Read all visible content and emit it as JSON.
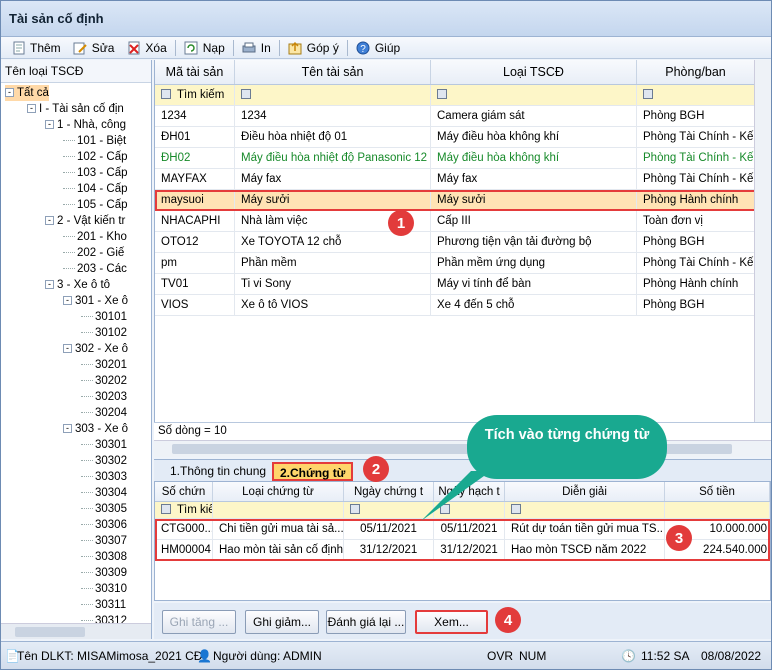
{
  "window": {
    "title": "Tài sản cố định"
  },
  "toolbar": {
    "items": [
      {
        "label": "Thêm",
        "icon": "add-icon"
      },
      {
        "label": "Sửa",
        "icon": "edit-icon"
      },
      {
        "label": "Xóa",
        "icon": "delete-icon"
      },
      {
        "label": "Nạp",
        "icon": "refresh-icon"
      },
      {
        "label": "In",
        "icon": "print-icon"
      },
      {
        "label": "Góp ý",
        "icon": "feedback-icon"
      },
      {
        "label": "Giúp",
        "icon": "help-icon"
      }
    ]
  },
  "tree": {
    "header": "Tên loại TSCĐ",
    "nodes": [
      {
        "label": "Tất cả",
        "box": "-",
        "selected": true
      },
      {
        "label": "I - Tài sản cố địn",
        "box": "-"
      },
      {
        "label": "1 - Nhà, công",
        "box": "-"
      },
      {
        "label": "101 - Biệt",
        "box": ""
      },
      {
        "label": "102 - Cấp",
        "box": ""
      },
      {
        "label": "103 - Cấp",
        "box": ""
      },
      {
        "label": "104 - Cấp",
        "box": ""
      },
      {
        "label": "105 - Cấp",
        "box": ""
      },
      {
        "label": "2 - Vật kiến tr",
        "box": "-"
      },
      {
        "label": "201 - Kho",
        "box": ""
      },
      {
        "label": "202 - Giế",
        "box": ""
      },
      {
        "label": "203 - Các",
        "box": ""
      },
      {
        "label": "3 - Xe ô tô",
        "box": "-"
      },
      {
        "label": "301 - Xe ô",
        "box": "-"
      },
      {
        "label": "30101",
        "box": ""
      },
      {
        "label": "30102",
        "box": ""
      },
      {
        "label": "302 - Xe ô",
        "box": "-"
      },
      {
        "label": "30201",
        "box": ""
      },
      {
        "label": "30202",
        "box": ""
      },
      {
        "label": "30203",
        "box": ""
      },
      {
        "label": "30204",
        "box": ""
      },
      {
        "label": "303 - Xe ô",
        "box": "-"
      },
      {
        "label": "30301",
        "box": ""
      },
      {
        "label": "30302",
        "box": ""
      },
      {
        "label": "30303",
        "box": ""
      },
      {
        "label": "30304",
        "box": ""
      },
      {
        "label": "30305",
        "box": ""
      },
      {
        "label": "30306",
        "box": ""
      },
      {
        "label": "30307",
        "box": ""
      },
      {
        "label": "30308",
        "box": ""
      },
      {
        "label": "30309",
        "box": ""
      },
      {
        "label": "30310",
        "box": ""
      },
      {
        "label": "30311",
        "box": ""
      },
      {
        "label": "30312",
        "box": ""
      }
    ]
  },
  "assets": {
    "columns": [
      "Mã tài sản",
      "Tên tài sản",
      "Loại TSCĐ",
      "Phòng/ban"
    ],
    "filter_label": "Tìm kiếm",
    "rows": [
      {
        "code": "1234",
        "name": "1234",
        "type": "Camera giám sát",
        "dept": "Phòng BGH",
        "style": ""
      },
      {
        "code": "ĐH01",
        "name": "Điều hòa nhiệt độ 01",
        "type": "Máy điều hòa không khí",
        "dept": "Phòng Tài Chính - Kế toán",
        "style": ""
      },
      {
        "code": "ĐH02",
        "name": "Máy điều hòa nhiệt độ Panasonic 12",
        "type": "Máy điều hòa không khí",
        "dept": "Phòng Tài Chính - Kế toán",
        "style": "green"
      },
      {
        "code": "MAYFAX",
        "name": "Máy fax",
        "type": "Máy fax",
        "dept": "Phòng Tài Chính - Kế toán",
        "style": ""
      },
      {
        "code": "maysuoi",
        "name": "Máy sưởi",
        "type": "Máy sưởi",
        "dept": "Phòng Hành chính",
        "style": "hl"
      },
      {
        "code": "NHACAPHI",
        "name": "Nhà làm việc",
        "type": "Cấp III",
        "dept": "Toàn đơn vị",
        "style": ""
      },
      {
        "code": "OTO12",
        "name": "Xe TOYOTA  12 chỗ",
        "type": "Phương tiện vận tải đường bộ",
        "dept": "Phòng BGH",
        "style": ""
      },
      {
        "code": "pm",
        "name": "Phần mềm",
        "type": "Phần mềm ứng dụng",
        "dept": "Phòng Tài Chính - Kế toán",
        "style": ""
      },
      {
        "code": "TV01",
        "name": "Ti vi Sony",
        "type": "Máy vi tính để bàn",
        "dept": "Phòng Hành chính",
        "style": ""
      },
      {
        "code": "VIOS",
        "name": "Xe ô tô VIOS",
        "type": "Xe 4 đến 5 chỗ",
        "dept": "Phòng BGH",
        "style": ""
      }
    ],
    "row_count": "Số dòng = 10"
  },
  "tabs": [
    {
      "label": "1.Thông tin chung",
      "active": false
    },
    {
      "label": "2.Chứng từ",
      "active": true
    }
  ],
  "vouchers": {
    "columns": [
      "Số chứn",
      "Loại chứng từ",
      "Ngày chứng t",
      "Ngày hạch t",
      "Diễn giải",
      "Số tiền"
    ],
    "filter_label": "Tìm kiếm",
    "rows": [
      {
        "no": "CTG000...",
        "type": "Chi tiền gửi mua tài sả...",
        "date": "05/11/2021",
        "post": "05/11/2021",
        "desc": "Rút dự toán tiền gửi mua TS...",
        "amount": "10.000.000"
      },
      {
        "no": "HM00004",
        "type": "Hao mòn tài sản cố định",
        "date": "31/12/2021",
        "post": "31/12/2021",
        "desc": "Hao mòn TSCĐ năm 2022",
        "amount": "224.540.000"
      }
    ]
  },
  "buttons": {
    "ghi_tang": "Ghi tăng ...",
    "ghi_giam": "Ghi giảm...",
    "danh_gia": "Đánh giá lại ...",
    "xem": "Xem..."
  },
  "callout": {
    "text": "Tích vào từng chứng từ"
  },
  "badges": [
    "1",
    "2",
    "3",
    "4"
  ],
  "status": {
    "db": "Tên DLKT: MISAMimosa_2021 CĐ",
    "user": "Người dùng: ADMIN",
    "ovr": "OVR",
    "num": "NUM",
    "time": "11:52 SA",
    "date": "08/08/2022"
  },
  "colors": {
    "highlight_border": "#e43b3b",
    "selected_row": "#ffe3b5",
    "callout": "#19a990",
    "green_text": "#178a2a"
  }
}
